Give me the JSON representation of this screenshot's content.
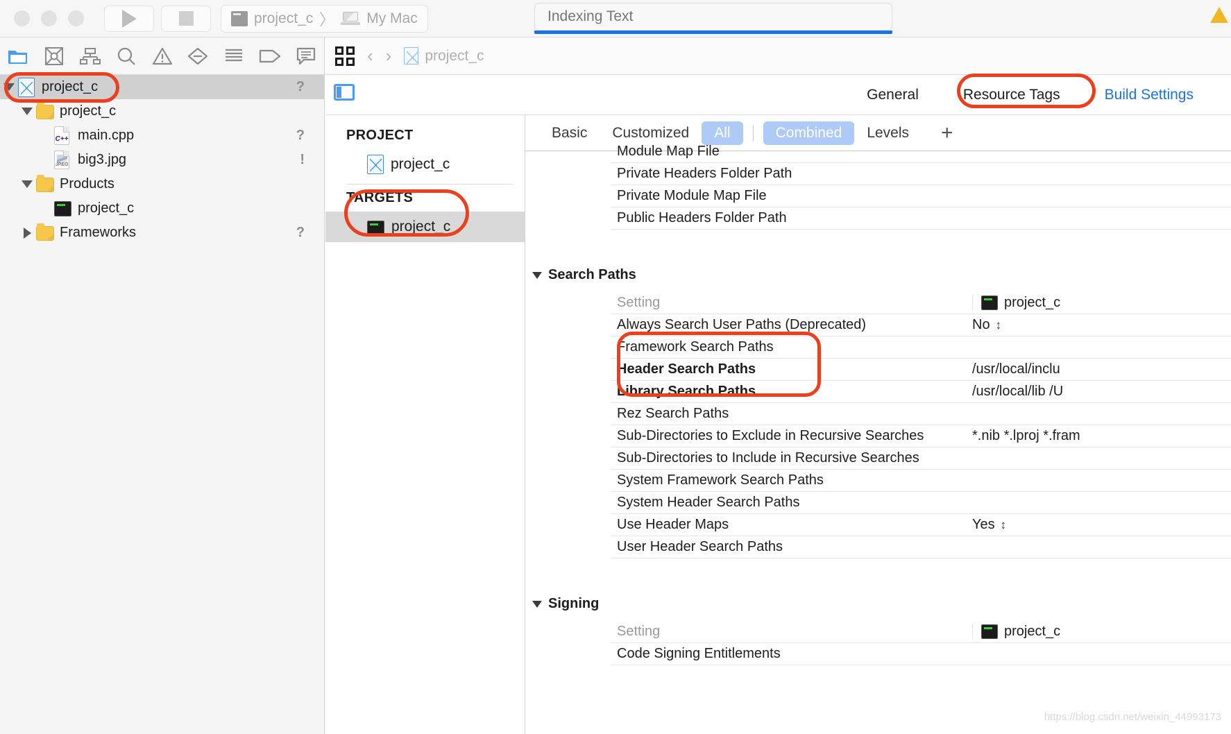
{
  "toolbar": {
    "run_label": "Run",
    "stop_label": "Stop",
    "scheme_project": "project_c",
    "scheme_separator": "〉",
    "scheme_destination": "My Mac",
    "status_text": "Indexing Text",
    "progress_percent": 100
  },
  "navigator": {
    "tabs": [
      {
        "name": "project-navigator",
        "label": "Project",
        "active": true
      },
      {
        "name": "source-control-navigator",
        "label": "Source Control",
        "active": false
      },
      {
        "name": "symbol-navigator",
        "label": "Symbol",
        "active": false
      },
      {
        "name": "find-navigator",
        "label": "Find",
        "active": false
      },
      {
        "name": "issue-navigator",
        "label": "Issue",
        "active": false
      },
      {
        "name": "test-navigator",
        "label": "Test",
        "active": false
      },
      {
        "name": "debug-navigator",
        "label": "Debug",
        "active": false
      },
      {
        "name": "breakpoint-navigator",
        "label": "Breakpoint",
        "active": false
      },
      {
        "name": "report-navigator",
        "label": "Report",
        "active": false
      }
    ],
    "rows": [
      {
        "label": "project_c",
        "icon": "xcodeproj-icon",
        "indent": 0,
        "twisty": "down",
        "selected": true,
        "mark": "?"
      },
      {
        "label": "project_c",
        "icon": "folder-icon",
        "indent": 1,
        "twisty": "down",
        "selected": false,
        "mark": ""
      },
      {
        "label": "main.cpp",
        "icon": "cpp-file-icon",
        "indent": 2,
        "twisty": "none",
        "selected": false,
        "mark": "?"
      },
      {
        "label": "big3.jpg",
        "icon": "jpeg-file-icon",
        "indent": 2,
        "twisty": "none",
        "selected": false,
        "mark": "!"
      },
      {
        "label": "Products",
        "icon": "folder-icon",
        "indent": 1,
        "twisty": "down",
        "selected": false,
        "mark": ""
      },
      {
        "label": "project_c",
        "icon": "executable-icon",
        "indent": 2,
        "twisty": "none",
        "selected": false,
        "mark": ""
      },
      {
        "label": "Frameworks",
        "icon": "folder-icon",
        "indent": 1,
        "twisty": "right",
        "selected": false,
        "mark": "?"
      }
    ]
  },
  "jumpbar": {
    "related_items_label": "Related Items",
    "back_label": "‹",
    "forward_label": "›",
    "path_label": "project_c"
  },
  "editor_tabs": [
    {
      "label": "General",
      "active": false
    },
    {
      "label": "Resource Tags",
      "active": false
    },
    {
      "label": "Build Settings",
      "active": true
    }
  ],
  "project_targets": {
    "project_header": "PROJECT",
    "project_items": [
      {
        "label": "project_c",
        "icon": "xcodeproj-icon",
        "selected": false
      }
    ],
    "targets_header": "TARGETS",
    "target_items": [
      {
        "label": "project_c",
        "icon": "executable-icon",
        "selected": true
      }
    ]
  },
  "build_settings": {
    "filters": [
      {
        "label": "Basic",
        "active": false
      },
      {
        "label": "Customized",
        "active": false
      },
      {
        "label": "All",
        "active": true
      },
      {
        "label": "Combined",
        "active": true
      },
      {
        "label": "Levels",
        "active": false
      }
    ],
    "add_label": "+",
    "value_column_header": "project_c",
    "setting_column_header": "Setting",
    "groups": [
      {
        "name": "",
        "show_header": false,
        "rows": [
          {
            "setting": "Module Map File",
            "value": "",
            "bold": false,
            "clipped": true
          },
          {
            "setting": "Private Headers Folder Path",
            "value": "",
            "bold": false
          },
          {
            "setting": "Private Module Map File",
            "value": "",
            "bold": false
          },
          {
            "setting": "Public Headers Folder Path",
            "value": "",
            "bold": false
          }
        ]
      },
      {
        "name": "Search Paths",
        "show_header": true,
        "column_setting": "Setting",
        "column_value": "project_c",
        "rows": [
          {
            "setting": "Always Search User Paths (Deprecated)",
            "value": "No",
            "bold": false,
            "stepper": true
          },
          {
            "setting": "Framework Search Paths",
            "value": "",
            "bold": false
          },
          {
            "setting": "Header Search Paths",
            "value": "/usr/local/inclu",
            "bold": true
          },
          {
            "setting": "Library Search Paths",
            "value": "/usr/local/lib /U",
            "bold": true
          },
          {
            "setting": "Rez Search Paths",
            "value": "",
            "bold": false
          },
          {
            "setting": "Sub-Directories to Exclude in Recursive Searches",
            "value": "*.nib *.lproj *.fram",
            "bold": false
          },
          {
            "setting": "Sub-Directories to Include in Recursive Searches",
            "value": "",
            "bold": false
          },
          {
            "setting": "System Framework Search Paths",
            "value": "",
            "bold": false
          },
          {
            "setting": "System Header Search Paths",
            "value": "",
            "bold": false
          },
          {
            "setting": "Use Header Maps",
            "value": "Yes",
            "bold": false,
            "stepper": true
          },
          {
            "setting": "User Header Search Paths",
            "value": "",
            "bold": false
          }
        ]
      },
      {
        "name": "Signing",
        "show_header": true,
        "column_setting": "Setting",
        "column_value": "project_c",
        "rows": [
          {
            "setting": "Code Signing Entitlements",
            "value": "",
            "bold": false
          }
        ]
      }
    ]
  },
  "annotations": {
    "color": "#ec3f1d",
    "highlights": [
      "project_c navigator row",
      "project_c target row",
      "Header Search Paths / Library Search Paths rows",
      "Build Settings tab"
    ]
  },
  "watermark": "https://blog.csdn.net/weixin_44993173"
}
